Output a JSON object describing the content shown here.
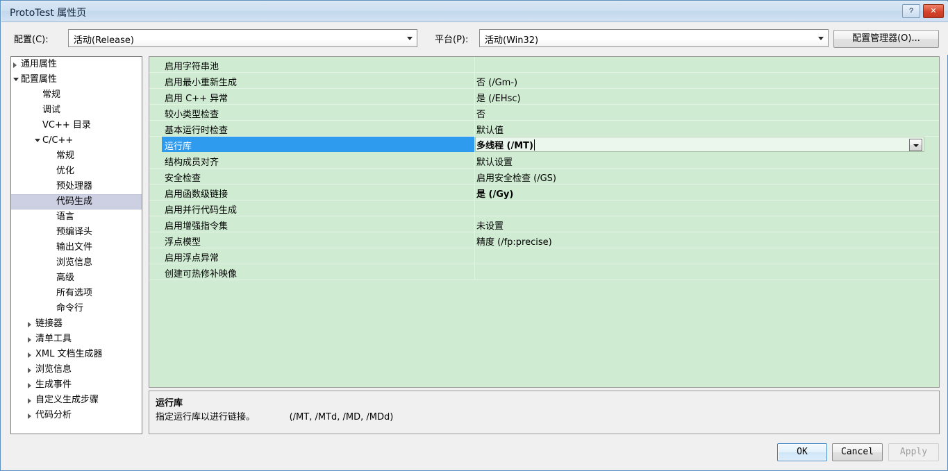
{
  "window": {
    "title": "ProtoTest 属性页",
    "help_button": "?",
    "close_button": "✕"
  },
  "config_bar": {
    "config_label": "配置(C):",
    "config_value": "活动(Release)",
    "platform_label": "平台(P):",
    "platform_value": "活动(Win32)",
    "config_manager_button": "配置管理器(O)..."
  },
  "tree": {
    "items": [
      {
        "label": "通用属性",
        "indent": 14,
        "arrow": "closed",
        "selected": false
      },
      {
        "label": "配置属性",
        "indent": 14,
        "arrow": "open",
        "selected": false
      },
      {
        "label": "常规",
        "indent": 45,
        "arrow": "none",
        "selected": false
      },
      {
        "label": "调试",
        "indent": 45,
        "arrow": "none",
        "selected": false
      },
      {
        "label": "VC++ 目录",
        "indent": 45,
        "arrow": "none",
        "selected": false
      },
      {
        "label": "C/C++",
        "indent": 45,
        "arrow": "open-sub",
        "selected": false
      },
      {
        "label": "常规",
        "indent": 65,
        "arrow": "none",
        "selected": false
      },
      {
        "label": "优化",
        "indent": 65,
        "arrow": "none",
        "selected": false
      },
      {
        "label": "预处理器",
        "indent": 65,
        "arrow": "none",
        "selected": false
      },
      {
        "label": "代码生成",
        "indent": 65,
        "arrow": "none",
        "selected": true
      },
      {
        "label": "语言",
        "indent": 65,
        "arrow": "none",
        "selected": false
      },
      {
        "label": "预编译头",
        "indent": 65,
        "arrow": "none",
        "selected": false
      },
      {
        "label": "输出文件",
        "indent": 65,
        "arrow": "none",
        "selected": false
      },
      {
        "label": "浏览信息",
        "indent": 65,
        "arrow": "none",
        "selected": false
      },
      {
        "label": "高级",
        "indent": 65,
        "arrow": "none",
        "selected": false
      },
      {
        "label": "所有选项",
        "indent": 65,
        "arrow": "none",
        "selected": false
      },
      {
        "label": "命令行",
        "indent": 65,
        "arrow": "none",
        "selected": false
      },
      {
        "label": "链接器",
        "indent": 35,
        "arrow": "closed",
        "selected": false
      },
      {
        "label": "清单工具",
        "indent": 35,
        "arrow": "closed",
        "selected": false
      },
      {
        "label": "XML 文档生成器",
        "indent": 35,
        "arrow": "closed",
        "selected": false
      },
      {
        "label": "浏览信息",
        "indent": 35,
        "arrow": "closed",
        "selected": false
      },
      {
        "label": "生成事件",
        "indent": 35,
        "arrow": "closed",
        "selected": false
      },
      {
        "label": "自定义生成步骤",
        "indent": 35,
        "arrow": "closed",
        "selected": false
      },
      {
        "label": "代码分析",
        "indent": 35,
        "arrow": "closed",
        "selected": false
      }
    ]
  },
  "grid": {
    "rows": [
      {
        "name": "启用字符串池",
        "value": "",
        "selected": false,
        "bold": false
      },
      {
        "name": "启用最小重新生成",
        "value": "否 (/Gm-)",
        "selected": false,
        "bold": false
      },
      {
        "name": "启用 C++ 异常",
        "value": "是 (/EHsc)",
        "selected": false,
        "bold": false
      },
      {
        "name": "较小类型检查",
        "value": "否",
        "selected": false,
        "bold": false
      },
      {
        "name": "基本运行时检查",
        "value": "默认值",
        "selected": false,
        "bold": false
      },
      {
        "name": "运行库",
        "value": "多线程 (/MT)",
        "selected": true,
        "bold": true
      },
      {
        "name": "结构成员对齐",
        "value": "默认设置",
        "selected": false,
        "bold": false
      },
      {
        "name": "安全检查",
        "value": "启用安全检查 (/GS)",
        "selected": false,
        "bold": false
      },
      {
        "name": "启用函数级链接",
        "value": "是 (/Gy)",
        "selected": false,
        "bold": true
      },
      {
        "name": "启用并行代码生成",
        "value": "",
        "selected": false,
        "bold": false
      },
      {
        "name": "启用增强指令集",
        "value": "未设置",
        "selected": false,
        "bold": false
      },
      {
        "name": "浮点模型",
        "value": "精度 (/fp:precise)",
        "selected": false,
        "bold": false
      },
      {
        "name": "启用浮点异常",
        "value": "",
        "selected": false,
        "bold": false
      },
      {
        "name": "创建可热修补映像",
        "value": "",
        "selected": false,
        "bold": false
      }
    ]
  },
  "description": {
    "title": "运行库",
    "body": "指定运行库以进行链接。            (/MT, /MTd, /MD, /MDd)"
  },
  "footer": {
    "ok": "OK",
    "cancel": "Cancel",
    "apply": "Apply"
  },
  "colors": {
    "grid_background": "#cfecd2",
    "selection_blue": "#2f9bee",
    "tree_selection": "#cdcfe2",
    "titlebar": "#cfe0f2",
    "close_button": "#d5452b"
  }
}
